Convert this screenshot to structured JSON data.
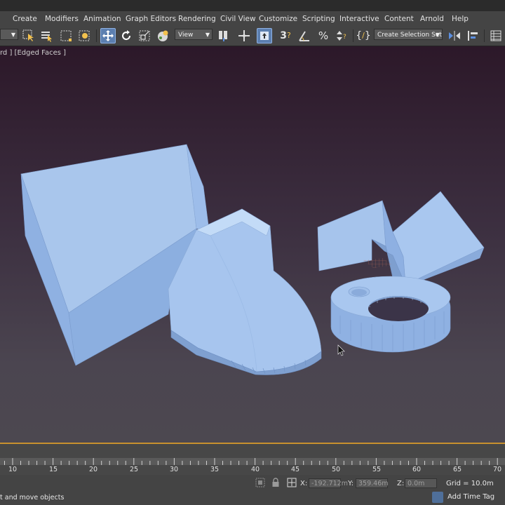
{
  "menu": {
    "items": [
      "Create",
      "Modifiers",
      "Animation",
      "Graph Editors",
      "Rendering",
      "Civil View",
      "Customize",
      "Scripting",
      "Interactive",
      "Content",
      "Arnold",
      "Help"
    ]
  },
  "toolbar": {
    "view_dropdown": "View",
    "selection_set_dropdown": "Create Selection Set",
    "icons": [
      "select-object-icon",
      "select-by-name-icon",
      "rectangular-selection-icon",
      "window-crossing-icon",
      "select-and-move-icon",
      "select-and-rotate-icon",
      "select-and-scale-icon",
      "shaded-sphere-icon",
      "use-pivot-icon",
      "select-manipulate-icon",
      "keyboard-shortcut-icon",
      "snaps-toggle-icon",
      "angle-snap-icon",
      "percent-snap-icon",
      "spinner-snap-icon",
      "named-selection-icon",
      "mirror-icon",
      "align-icon",
      "layer-explorer-icon"
    ]
  },
  "viewport": {
    "label": "rd ] [Edged Faces ]"
  },
  "timeline": {
    "ticks": [
      "10",
      "15",
      "20",
      "25",
      "30",
      "35",
      "40",
      "45",
      "50",
      "55",
      "60",
      "65",
      "70"
    ]
  },
  "status": {
    "message": "t and move objects",
    "x_label": "X:",
    "x_value": "-192.712m",
    "y_label": "Y:",
    "y_value": "359.46m",
    "z_label": "Z:",
    "z_value": "0.0m",
    "grid": "Grid = 10.0m",
    "add_time_tag": "Add Time Tag"
  },
  "colors": {
    "object_fill": "#9ebfe8",
    "accent": "#c8912e"
  }
}
